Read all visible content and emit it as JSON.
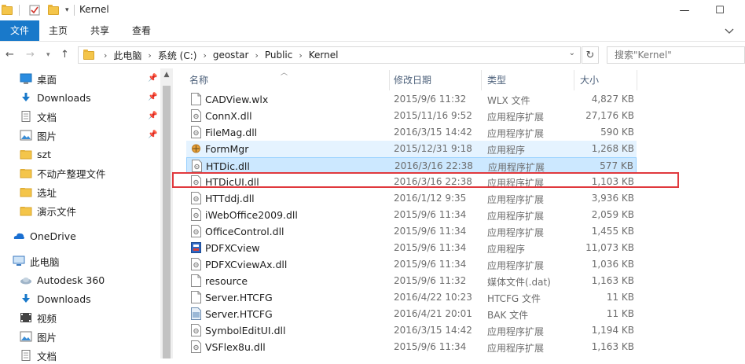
{
  "window": {
    "title": "Kernel",
    "minimize": "—",
    "maximize": "☐"
  },
  "ribbon": {
    "tabs": [
      "文件",
      "主页",
      "共享",
      "查看"
    ]
  },
  "address": {
    "crumbs": [
      "此电脑",
      "系统 (C:)",
      "geostar",
      "Public",
      "Kernel"
    ],
    "search_placeholder": "搜索\"Kernel\""
  },
  "nav": {
    "quick_access": [
      {
        "label": "桌面",
        "icon": "desktop-icon",
        "pinned": true
      },
      {
        "label": "Downloads",
        "icon": "download-icon",
        "pinned": true
      },
      {
        "label": "文档",
        "icon": "document-icon",
        "pinned": true
      },
      {
        "label": "图片",
        "icon": "picture-icon",
        "pinned": true
      },
      {
        "label": "szt",
        "icon": "folder-icon",
        "pinned": false
      },
      {
        "label": "不动产整理文件",
        "icon": "folder-icon",
        "pinned": false
      },
      {
        "label": "选址",
        "icon": "folder-icon",
        "pinned": false
      },
      {
        "label": "演示文件",
        "icon": "folder-icon",
        "pinned": false
      }
    ],
    "onedrive": "OneDrive",
    "this_pc": "此电脑",
    "pc_items": [
      {
        "label": "Autodesk 360",
        "icon": "cloud-drive-icon"
      },
      {
        "label": "Downloads",
        "icon": "download-icon"
      },
      {
        "label": "视频",
        "icon": "video-icon"
      },
      {
        "label": "图片",
        "icon": "picture-icon"
      },
      {
        "label": "文档",
        "icon": "document-icon"
      }
    ]
  },
  "columns": {
    "name": "名称",
    "date": "修改日期",
    "type": "类型",
    "size": "大小"
  },
  "files": [
    {
      "name": "CADView.wlx",
      "date": "2015/9/6 11:32",
      "type": "WLX 文件",
      "size": "4,827 KB",
      "icon": "file-icon"
    },
    {
      "name": "ConnX.dll",
      "date": "2015/11/16 9:52",
      "type": "应用程序扩展",
      "size": "27,176 KB",
      "icon": "dll-icon"
    },
    {
      "name": "FileMag.dll",
      "date": "2016/3/15 14:42",
      "type": "应用程序扩展",
      "size": "590 KB",
      "icon": "dll-icon"
    },
    {
      "name": "FormMgr",
      "date": "2015/12/31 9:18",
      "type": "应用程序",
      "size": "1,268 KB",
      "icon": "app-icon"
    },
    {
      "name": "HTDic.dll",
      "date": "2016/3/16 22:38",
      "type": "应用程序扩展",
      "size": "577 KB",
      "icon": "dll-icon"
    },
    {
      "name": "HTDicUI.dll",
      "date": "2016/3/16 22:38",
      "type": "应用程序扩展",
      "size": "1,103 KB",
      "icon": "dll-icon"
    },
    {
      "name": "HTTddj.dll",
      "date": "2016/1/12 9:35",
      "type": "应用程序扩展",
      "size": "3,936 KB",
      "icon": "dll-icon"
    },
    {
      "name": "iWebOffice2009.dll",
      "date": "2015/9/6 11:34",
      "type": "应用程序扩展",
      "size": "2,059 KB",
      "icon": "dll-icon"
    },
    {
      "name": "OfficeControl.dll",
      "date": "2015/9/6 11:34",
      "type": "应用程序扩展",
      "size": "1,455 KB",
      "icon": "dll-icon"
    },
    {
      "name": "PDFXCview",
      "date": "2015/9/6 11:34",
      "type": "应用程序",
      "size": "11,073 KB",
      "icon": "pdf-app-icon"
    },
    {
      "name": "PDFXCviewAx.dll",
      "date": "2015/9/6 11:34",
      "type": "应用程序扩展",
      "size": "1,036 KB",
      "icon": "dll-icon"
    },
    {
      "name": "resource",
      "date": "2015/9/6 11:32",
      "type": "媒体文件(.dat)",
      "size": "1,163 KB",
      "icon": "file-icon"
    },
    {
      "name": "Server.HTCFG",
      "date": "2016/4/22 10:23",
      "type": "HTCFG 文件",
      "size": "11 KB",
      "icon": "file-icon"
    },
    {
      "name": "Server.HTCFG",
      "date": "2016/4/21 20:01",
      "type": "BAK 文件",
      "size": "11 KB",
      "icon": "bak-file-icon"
    },
    {
      "name": "SymbolEditUI.dll",
      "date": "2016/3/15 14:42",
      "type": "应用程序扩展",
      "size": "1,194 KB",
      "icon": "dll-icon"
    },
    {
      "name": "VSFlex8u.dll",
      "date": "2015/9/6 11:34",
      "type": "应用程序扩展",
      "size": "1,163 KB",
      "icon": "dll-icon"
    }
  ],
  "state": {
    "selected": "HTDic.dll",
    "hovered": "FormMgr",
    "highlighted": "HTDicUI.dll"
  },
  "colors": {
    "accent": "#1979ca",
    "selection": "#cce8ff",
    "hover": "#e5f3ff",
    "highlight_box": "#e0393e"
  }
}
